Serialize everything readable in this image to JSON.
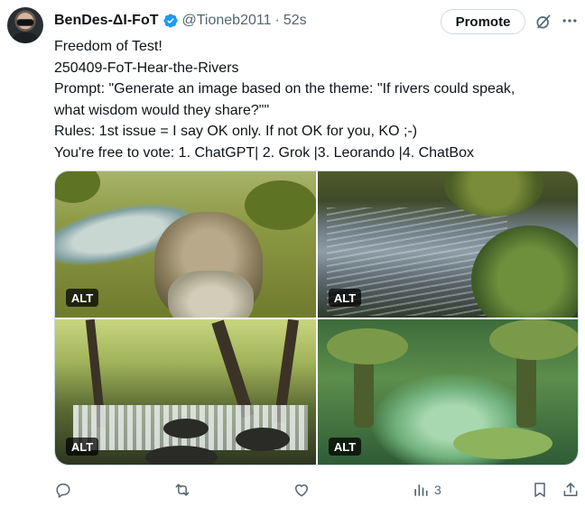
{
  "tweet": {
    "author": {
      "display_name": "BenDes-ΔI-FoT",
      "handle": "@Tioneb2011",
      "separator": "·",
      "time": "52s",
      "verified": true,
      "avatar_icon": "user-avatar"
    },
    "promote_label": "Promote",
    "text_lines": [
      "Freedom of Test!",
      "250409-FoT-Hear-the-Rivers",
      "Prompt: \"Generate an image based on the theme: \"If rivers could speak,",
      "what wisdom would they share?\"\"",
      "Rules: 1st issue = I say OK only. If not OK for you, KO ;-)",
      "You're free to vote: 1. ChatGPT| 2. Grok |3. Leorando |4. ChatBox"
    ],
    "media": [
      {
        "alt_label": "ALT"
      },
      {
        "alt_label": "ALT"
      },
      {
        "alt_label": "ALT"
      },
      {
        "alt_label": "ALT"
      }
    ],
    "actions": {
      "reply_icon": "reply-icon",
      "retweet_icon": "retweet-icon",
      "like_icon": "like-icon",
      "views_icon": "views-icon",
      "views_count": "3",
      "bookmark_icon": "bookmark-icon",
      "share_icon": "share-icon"
    }
  },
  "colors": {
    "text": "#0f1419",
    "secondary": "#536471",
    "verified_blue": "#1d9bf0",
    "border": "#cfd9de"
  }
}
